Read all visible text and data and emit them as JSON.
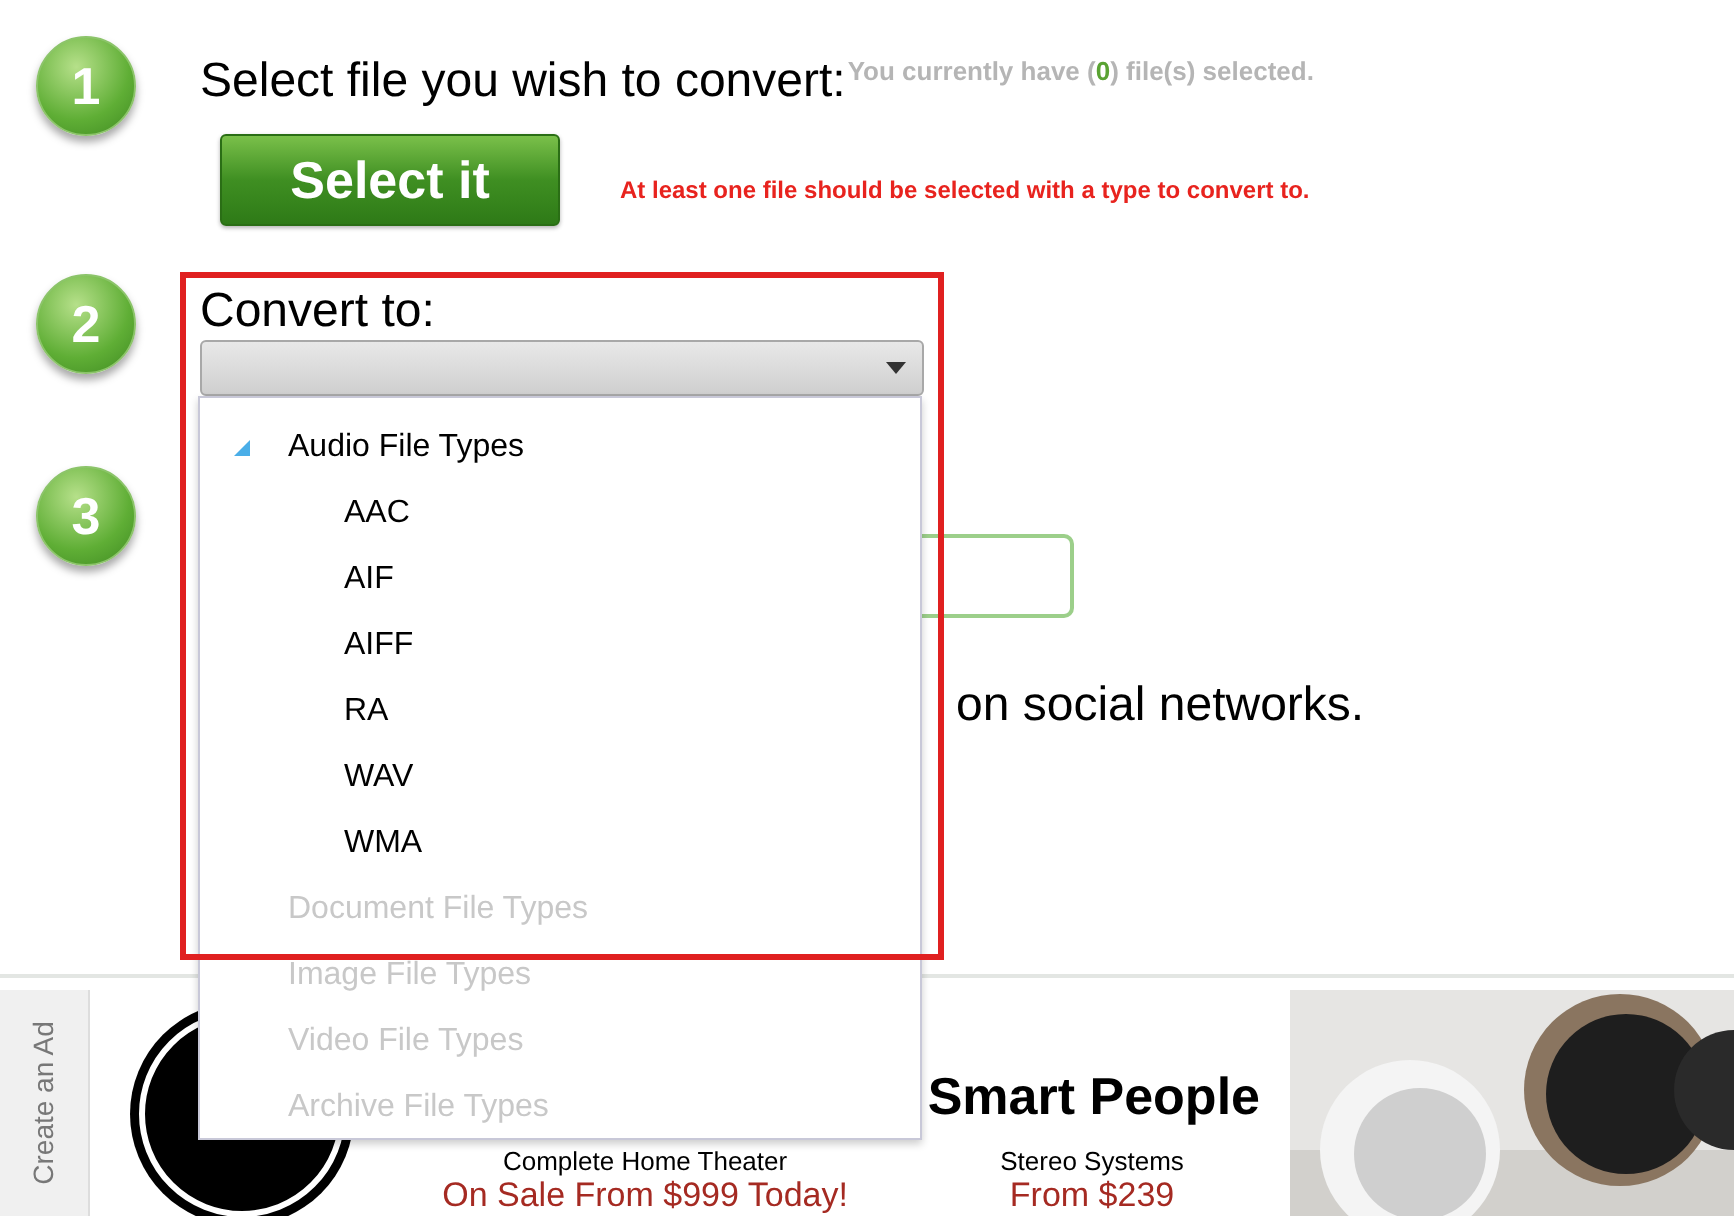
{
  "steps": [
    {
      "number": "1",
      "title": "Select file you wish to convert:",
      "status": {
        "prefix": "You currently have (",
        "count": "0",
        "suffix": ") file(s) selected."
      },
      "button": "Select it",
      "warning": "At least one file should be selected with a type to convert to."
    },
    {
      "number": "2",
      "title": "Convert to:"
    },
    {
      "number": "3",
      "share_text": "on social networks."
    }
  ],
  "dropdown": {
    "groups": [
      {
        "label": "Audio File Types",
        "expanded": true,
        "disabled": false,
        "children": [
          "AAC",
          "AIF",
          "AIFF",
          "RA",
          "WAV",
          "WMA"
        ]
      },
      {
        "label": "Document File Types",
        "expanded": false,
        "disabled": true
      },
      {
        "label": "Image File Types",
        "expanded": false,
        "disabled": true
      },
      {
        "label": "Video File Types",
        "expanded": false,
        "disabled": true
      },
      {
        "label": "Archive File Types",
        "expanded": false,
        "disabled": true
      }
    ]
  },
  "ad": {
    "side_label": "Create an Ad",
    "headline": "Smart People",
    "offers": [
      {
        "line": "Complete Home Theater",
        "price": "On Sale From $999 Today!"
      },
      {
        "line": "Stereo Systems",
        "price": "From $239"
      }
    ]
  }
}
